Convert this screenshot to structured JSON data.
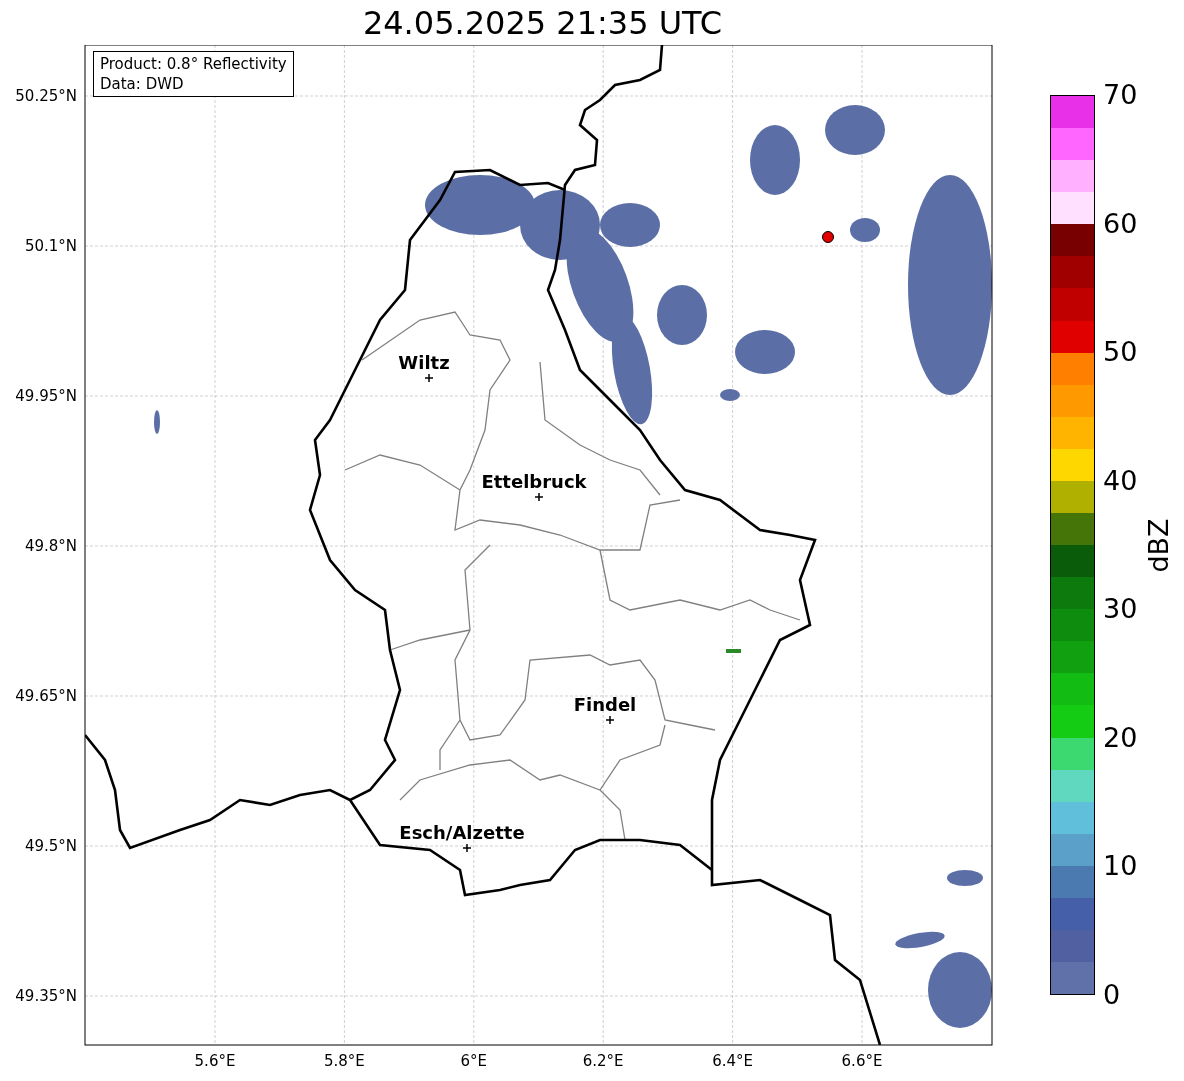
{
  "title": "24.05.2025 21:35 UTC",
  "info_box": [
    "Product: 0.8° Reflectivity",
    "Data: DWD"
  ],
  "map": {
    "y_ticks": [
      "50.25°N",
      "50.1°N",
      "49.95°N",
      "49.8°N",
      "49.65°N",
      "49.5°N",
      "49.35°N"
    ],
    "x_ticks": [
      "5.6°E",
      "5.8°E",
      "6°E",
      "6.2°E",
      "6.4°E",
      "6.6°E"
    ],
    "cities": [
      {
        "name": "Wiltz"
      },
      {
        "name": "Ettelbruck"
      },
      {
        "name": "Findel"
      },
      {
        "name": "Esch/Alzette"
      }
    ]
  },
  "colorbar": {
    "label": "dBZ",
    "ticks": [
      "70",
      "60",
      "50",
      "40",
      "30",
      "20",
      "10",
      "0"
    ],
    "bands": [
      {
        "color": "#e830e8"
      },
      {
        "color": "#ff66ff"
      },
      {
        "color": "#ffb0ff"
      },
      {
        "color": "#ffe0ff"
      },
      {
        "color": "#780000"
      },
      {
        "color": "#a00000"
      },
      {
        "color": "#c00000"
      },
      {
        "color": "#e00000"
      },
      {
        "color": "#ff7f00"
      },
      {
        "color": "#ff9900"
      },
      {
        "color": "#ffb400"
      },
      {
        "color": "#ffd700"
      },
      {
        "color": "#b0b000"
      },
      {
        "color": "#457508"
      },
      {
        "color": "#0a5c0a"
      },
      {
        "color": "#0c7a0c"
      },
      {
        "color": "#0e8c0e"
      },
      {
        "color": "#10a010"
      },
      {
        "color": "#12bc12"
      },
      {
        "color": "#14cc14"
      },
      {
        "color": "#3cd870"
      },
      {
        "color": "#60d8c0"
      },
      {
        "color": "#60c0dc"
      },
      {
        "color": "#5aa0c8"
      },
      {
        "color": "#4a7ab0"
      },
      {
        "color": "#4560a8"
      },
      {
        "color": "#5060a0"
      },
      {
        "color": "#6070a8"
      }
    ]
  }
}
